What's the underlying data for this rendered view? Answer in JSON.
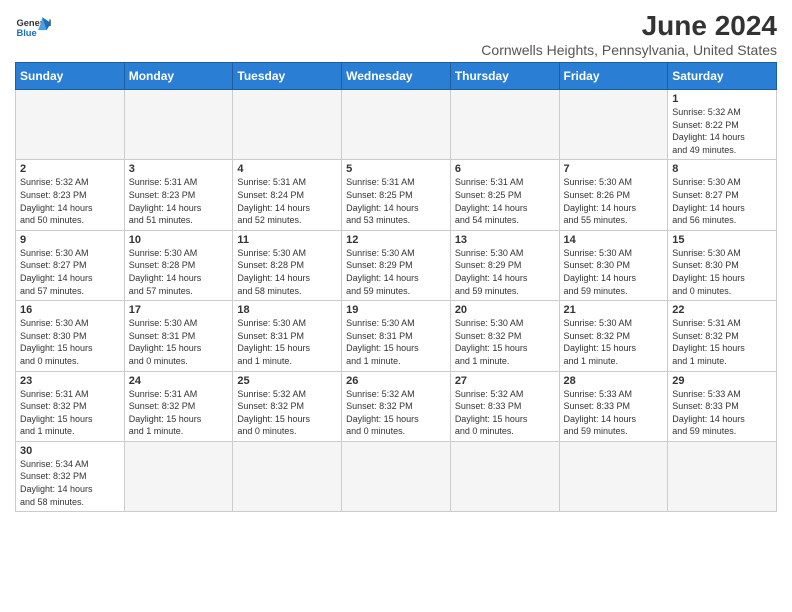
{
  "header": {
    "logo_line1": "General",
    "logo_line2": "Blue",
    "month_title": "June 2024",
    "location": "Cornwells Heights, Pennsylvania, United States"
  },
  "days_of_week": [
    "Sunday",
    "Monday",
    "Tuesday",
    "Wednesday",
    "Thursday",
    "Friday",
    "Saturday"
  ],
  "weeks": [
    [
      {
        "day": "",
        "info": ""
      },
      {
        "day": "",
        "info": ""
      },
      {
        "day": "",
        "info": ""
      },
      {
        "day": "",
        "info": ""
      },
      {
        "day": "",
        "info": ""
      },
      {
        "day": "",
        "info": ""
      },
      {
        "day": "1",
        "info": "Sunrise: 5:32 AM\nSunset: 8:22 PM\nDaylight: 14 hours\nand 49 minutes."
      }
    ],
    [
      {
        "day": "2",
        "info": "Sunrise: 5:32 AM\nSunset: 8:23 PM\nDaylight: 14 hours\nand 50 minutes."
      },
      {
        "day": "3",
        "info": "Sunrise: 5:31 AM\nSunset: 8:23 PM\nDaylight: 14 hours\nand 51 minutes."
      },
      {
        "day": "4",
        "info": "Sunrise: 5:31 AM\nSunset: 8:24 PM\nDaylight: 14 hours\nand 52 minutes."
      },
      {
        "day": "5",
        "info": "Sunrise: 5:31 AM\nSunset: 8:25 PM\nDaylight: 14 hours\nand 53 minutes."
      },
      {
        "day": "6",
        "info": "Sunrise: 5:31 AM\nSunset: 8:25 PM\nDaylight: 14 hours\nand 54 minutes."
      },
      {
        "day": "7",
        "info": "Sunrise: 5:30 AM\nSunset: 8:26 PM\nDaylight: 14 hours\nand 55 minutes."
      },
      {
        "day": "8",
        "info": "Sunrise: 5:30 AM\nSunset: 8:27 PM\nDaylight: 14 hours\nand 56 minutes."
      }
    ],
    [
      {
        "day": "9",
        "info": "Sunrise: 5:30 AM\nSunset: 8:27 PM\nDaylight: 14 hours\nand 57 minutes."
      },
      {
        "day": "10",
        "info": "Sunrise: 5:30 AM\nSunset: 8:28 PM\nDaylight: 14 hours\nand 57 minutes."
      },
      {
        "day": "11",
        "info": "Sunrise: 5:30 AM\nSunset: 8:28 PM\nDaylight: 14 hours\nand 58 minutes."
      },
      {
        "day": "12",
        "info": "Sunrise: 5:30 AM\nSunset: 8:29 PM\nDaylight: 14 hours\nand 59 minutes."
      },
      {
        "day": "13",
        "info": "Sunrise: 5:30 AM\nSunset: 8:29 PM\nDaylight: 14 hours\nand 59 minutes."
      },
      {
        "day": "14",
        "info": "Sunrise: 5:30 AM\nSunset: 8:30 PM\nDaylight: 14 hours\nand 59 minutes."
      },
      {
        "day": "15",
        "info": "Sunrise: 5:30 AM\nSunset: 8:30 PM\nDaylight: 15 hours\nand 0 minutes."
      }
    ],
    [
      {
        "day": "16",
        "info": "Sunrise: 5:30 AM\nSunset: 8:30 PM\nDaylight: 15 hours\nand 0 minutes."
      },
      {
        "day": "17",
        "info": "Sunrise: 5:30 AM\nSunset: 8:31 PM\nDaylight: 15 hours\nand 0 minutes."
      },
      {
        "day": "18",
        "info": "Sunrise: 5:30 AM\nSunset: 8:31 PM\nDaylight: 15 hours\nand 1 minute."
      },
      {
        "day": "19",
        "info": "Sunrise: 5:30 AM\nSunset: 8:31 PM\nDaylight: 15 hours\nand 1 minute."
      },
      {
        "day": "20",
        "info": "Sunrise: 5:30 AM\nSunset: 8:32 PM\nDaylight: 15 hours\nand 1 minute."
      },
      {
        "day": "21",
        "info": "Sunrise: 5:30 AM\nSunset: 8:32 PM\nDaylight: 15 hours\nand 1 minute."
      },
      {
        "day": "22",
        "info": "Sunrise: 5:31 AM\nSunset: 8:32 PM\nDaylight: 15 hours\nand 1 minute."
      }
    ],
    [
      {
        "day": "23",
        "info": "Sunrise: 5:31 AM\nSunset: 8:32 PM\nDaylight: 15 hours\nand 1 minute."
      },
      {
        "day": "24",
        "info": "Sunrise: 5:31 AM\nSunset: 8:32 PM\nDaylight: 15 hours\nand 1 minute."
      },
      {
        "day": "25",
        "info": "Sunrise: 5:32 AM\nSunset: 8:32 PM\nDaylight: 15 hours\nand 0 minutes."
      },
      {
        "day": "26",
        "info": "Sunrise: 5:32 AM\nSunset: 8:32 PM\nDaylight: 15 hours\nand 0 minutes."
      },
      {
        "day": "27",
        "info": "Sunrise: 5:32 AM\nSunset: 8:33 PM\nDaylight: 15 hours\nand 0 minutes."
      },
      {
        "day": "28",
        "info": "Sunrise: 5:33 AM\nSunset: 8:33 PM\nDaylight: 14 hours\nand 59 minutes."
      },
      {
        "day": "29",
        "info": "Sunrise: 5:33 AM\nSunset: 8:33 PM\nDaylight: 14 hours\nand 59 minutes."
      }
    ],
    [
      {
        "day": "30",
        "info": "Sunrise: 5:34 AM\nSunset: 8:32 PM\nDaylight: 14 hours\nand 58 minutes."
      },
      {
        "day": "",
        "info": ""
      },
      {
        "day": "",
        "info": ""
      },
      {
        "day": "",
        "info": ""
      },
      {
        "day": "",
        "info": ""
      },
      {
        "day": "",
        "info": ""
      },
      {
        "day": "",
        "info": ""
      }
    ]
  ]
}
